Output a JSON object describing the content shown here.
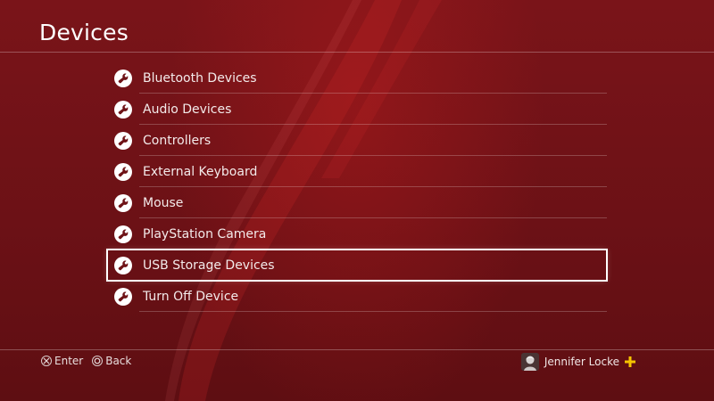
{
  "header": {
    "title": "Devices"
  },
  "menu": {
    "items": [
      {
        "label": "Bluetooth Devices",
        "icon": "wrench-icon"
      },
      {
        "label": "Audio Devices",
        "icon": "wrench-icon"
      },
      {
        "label": "Controllers",
        "icon": "wrench-icon"
      },
      {
        "label": "External Keyboard",
        "icon": "wrench-icon"
      },
      {
        "label": "Mouse",
        "icon": "wrench-icon"
      },
      {
        "label": "PlayStation Camera",
        "icon": "wrench-icon"
      },
      {
        "label": "USB Storage Devices",
        "icon": "wrench-icon",
        "selected": true
      },
      {
        "label": "Turn Off Device",
        "icon": "wrench-icon"
      }
    ]
  },
  "footer": {
    "enter_label": "Enter",
    "back_label": "Back",
    "user_name": "Jennifer Locke"
  },
  "colors": {
    "background": "#6e1216",
    "accent_plus": "#f5c400",
    "text": "#ffffff"
  }
}
